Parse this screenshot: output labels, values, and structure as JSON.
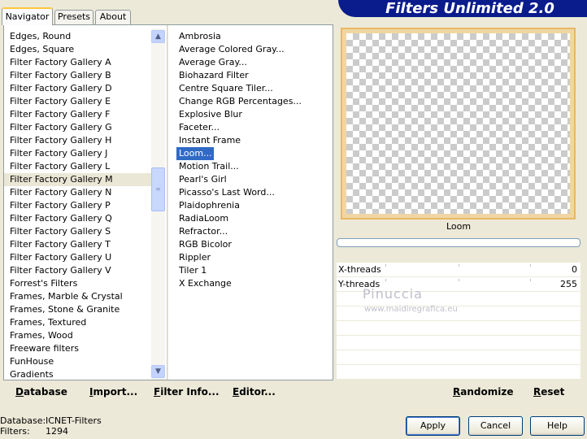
{
  "tabs": [
    "Navigator",
    "Presets",
    "About"
  ],
  "app_title": "Filters Unlimited 2.0",
  "categories": [
    "Edges, Round",
    "Edges, Square",
    "Filter Factory Gallery A",
    "Filter Factory Gallery B",
    "Filter Factory Gallery D",
    "Filter Factory Gallery E",
    "Filter Factory Gallery F",
    "Filter Factory Gallery G",
    "Filter Factory Gallery H",
    "Filter Factory Gallery J",
    "Filter Factory Gallery L",
    "Filter Factory Gallery M",
    "Filter Factory Gallery N",
    "Filter Factory Gallery P",
    "Filter Factory Gallery Q",
    "Filter Factory Gallery S",
    "Filter Factory Gallery T",
    "Filter Factory Gallery U",
    "Filter Factory Gallery V",
    "Forrest's Filters",
    "Frames, Marble & Crystal",
    "Frames, Stone & Granite",
    "Frames, Textured",
    "Frames, Wood",
    "Freeware filters",
    "FunHouse",
    "Gradients"
  ],
  "selected_category": "Filter Factory Gallery M",
  "filters": [
    "Ambrosia",
    "Average Colored Gray...",
    "Average Gray...",
    "Biohazard Filter",
    "Centre Square Tiler...",
    "Change RGB Percentages...",
    "Explosive Blur",
    "Faceter...",
    "Instant Frame",
    "Loom...",
    "Motion Trail...",
    "Pearl's Girl",
    "Picasso's Last Word...",
    "Plaidophrenia",
    "RadiaLoom",
    "Refractor...",
    "RGB Bicolor",
    "Rippler",
    "Tiler 1",
    "X Exchange"
  ],
  "selected_filter": "Loom...",
  "preview": {
    "filter_name": "Loom",
    "progress": 0
  },
  "params": [
    {
      "name": "X-threads",
      "value": "0"
    },
    {
      "name": "Y-threads",
      "value": "255"
    }
  ],
  "watermark": {
    "name": "Pinuccia",
    "url": "www.maidiregrafica.eu"
  },
  "bottom_links": {
    "database": "Database",
    "import": "Import...",
    "filter_info": "Filter Info...",
    "editor": "Editor...",
    "randomize": "Randomize",
    "reset": "Reset"
  },
  "status": {
    "database_label": "Database:",
    "database_value": "ICNET-Filters",
    "filters_label": "Filters:",
    "filters_value": "1294"
  },
  "buttons": {
    "apply": "Apply",
    "cancel": "Cancel",
    "help": "Help"
  },
  "colors": {
    "title_bg": "#0a1c8c",
    "selection": "#316ac5",
    "tab_highlight": "#ffc83c",
    "preview_border": "#e8b865"
  }
}
